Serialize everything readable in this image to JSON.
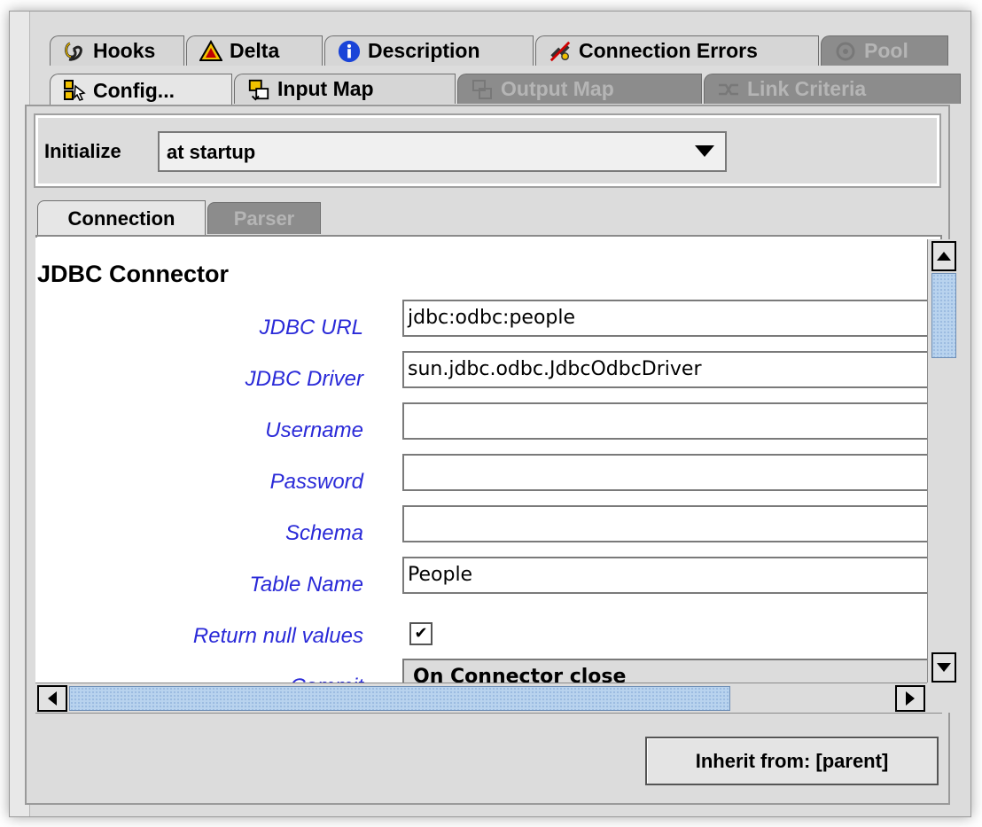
{
  "tabs_row1": [
    {
      "label": "Hooks",
      "icon": "hook-icon",
      "state": "normal"
    },
    {
      "label": "Delta",
      "icon": "delta-warning-icon",
      "state": "normal"
    },
    {
      "label": "Description",
      "icon": "info-icon",
      "state": "normal"
    },
    {
      "label": "Connection Errors",
      "icon": "connection-error-icon",
      "state": "normal"
    },
    {
      "label": "Pool",
      "icon": "pool-icon",
      "state": "disabled"
    }
  ],
  "tabs_row2": [
    {
      "label": "Config...",
      "icon": "config-icon",
      "state": "selected"
    },
    {
      "label": "Input Map",
      "icon": "input-map-icon",
      "state": "normal"
    },
    {
      "label": "Output Map",
      "icon": "output-map-icon",
      "state": "disabled"
    },
    {
      "label": "Link Criteria",
      "icon": "link-criteria-icon",
      "state": "disabled"
    }
  ],
  "initialize": {
    "label": "Initialize",
    "value": "at startup"
  },
  "subtabs": [
    {
      "label": "Connection",
      "state": "selected"
    },
    {
      "label": "Parser",
      "state": "disabled"
    }
  ],
  "connector": {
    "title": "JDBC Connector",
    "fields": [
      {
        "label": "JDBC URL",
        "value": "jdbc:odbc:people"
      },
      {
        "label": "JDBC Driver",
        "value": "sun.jdbc.odbc.JdbcOdbcDriver"
      },
      {
        "label": "Username",
        "value": ""
      },
      {
        "label": "Password",
        "value": ""
      },
      {
        "label": "Schema",
        "value": ""
      },
      {
        "label": "Table Name",
        "value": "People"
      }
    ],
    "return_null": {
      "label": "Return null values",
      "checked": true,
      "mark": "✔"
    },
    "partial": {
      "label": "Commit",
      "value": "On Connector close"
    }
  },
  "inherit_button": "Inherit from: [parent]",
  "colors": {
    "field_label": "#2a2ad8",
    "scroll_thumb": "#b9d3ee",
    "disabled_tab": "#8c8c8c"
  }
}
